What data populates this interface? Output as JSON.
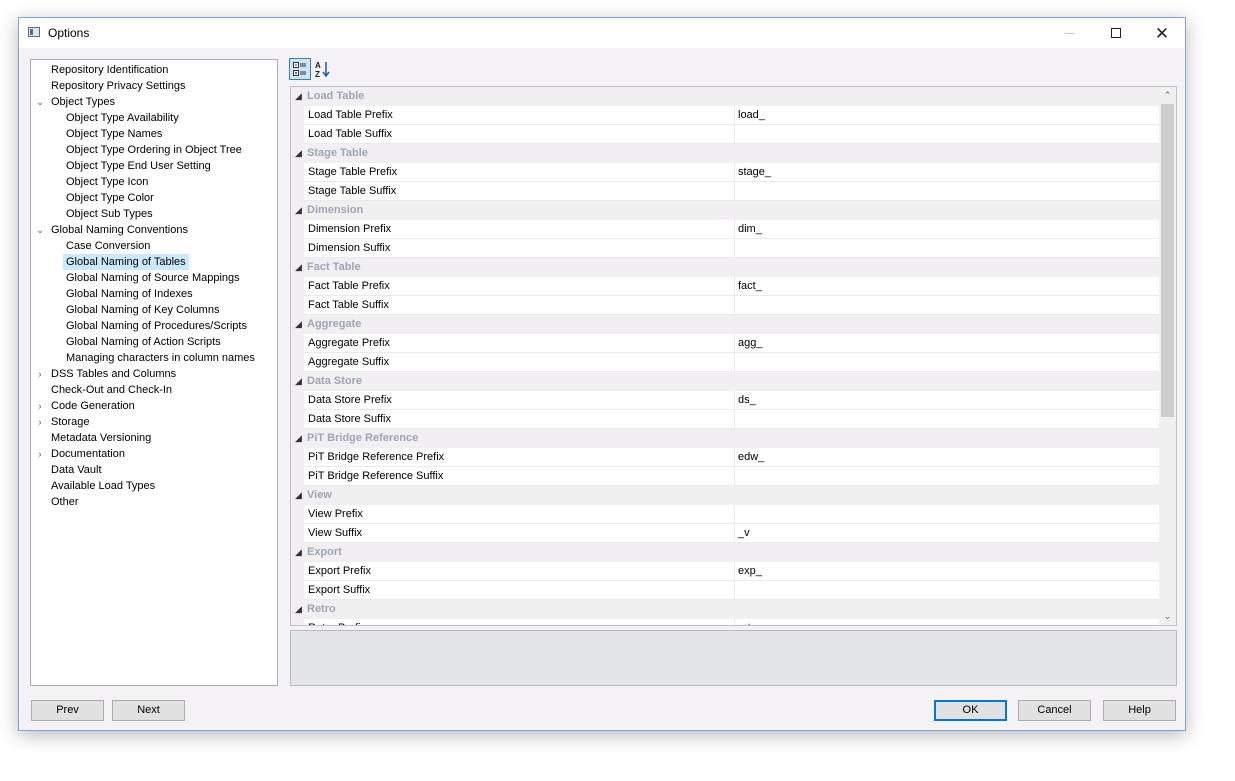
{
  "window": {
    "title": "Options"
  },
  "tree": [
    {
      "label": "Repository Identification",
      "indent": 0,
      "expander": ""
    },
    {
      "label": "Repository Privacy Settings",
      "indent": 0,
      "expander": ""
    },
    {
      "label": "Object Types",
      "indent": 0,
      "expander": "expanded"
    },
    {
      "label": "Object Type Availability",
      "indent": 1,
      "expander": ""
    },
    {
      "label": "Object Type Names",
      "indent": 1,
      "expander": ""
    },
    {
      "label": "Object Type Ordering in Object Tree",
      "indent": 1,
      "expander": ""
    },
    {
      "label": "Object Type End User Setting",
      "indent": 1,
      "expander": ""
    },
    {
      "label": "Object Type Icon",
      "indent": 1,
      "expander": ""
    },
    {
      "label": "Object Type Color",
      "indent": 1,
      "expander": ""
    },
    {
      "label": "Object Sub Types",
      "indent": 1,
      "expander": ""
    },
    {
      "label": "Global Naming Conventions",
      "indent": 0,
      "expander": "expanded"
    },
    {
      "label": "Case Conversion",
      "indent": 1,
      "expander": ""
    },
    {
      "label": "Global Naming of Tables",
      "indent": 1,
      "expander": "",
      "selected": true
    },
    {
      "label": "Global Naming of Source Mappings",
      "indent": 1,
      "expander": ""
    },
    {
      "label": "Global Naming of Indexes",
      "indent": 1,
      "expander": ""
    },
    {
      "label": "Global Naming of Key Columns",
      "indent": 1,
      "expander": ""
    },
    {
      "label": "Global Naming of Procedures/Scripts",
      "indent": 1,
      "expander": ""
    },
    {
      "label": "Global Naming of Action Scripts",
      "indent": 1,
      "expander": ""
    },
    {
      "label": "Managing characters in column names",
      "indent": 1,
      "expander": ""
    },
    {
      "label": "DSS Tables and Columns",
      "indent": 0,
      "expander": "collapsed"
    },
    {
      "label": "Check-Out and Check-In",
      "indent": 0,
      "expander": ""
    },
    {
      "label": "Code Generation",
      "indent": 0,
      "expander": "collapsed"
    },
    {
      "label": "Storage",
      "indent": 0,
      "expander": "collapsed"
    },
    {
      "label": "Metadata Versioning",
      "indent": 0,
      "expander": ""
    },
    {
      "label": "Documentation",
      "indent": 0,
      "expander": "collapsed"
    },
    {
      "label": "Data Vault",
      "indent": 0,
      "expander": ""
    },
    {
      "label": "Available Load Types",
      "indent": 0,
      "expander": ""
    },
    {
      "label": "Other",
      "indent": 0,
      "expander": ""
    }
  ],
  "toolbar": {
    "categorized_icon": "categorized-view-icon",
    "alphabetical_icon": "sort-alphabetical-icon"
  },
  "grid": {
    "categories": [
      {
        "name": "Load Table",
        "props": [
          {
            "name": "Load Table Prefix",
            "value": "load_"
          },
          {
            "name": "Load Table Suffix",
            "value": ""
          }
        ]
      },
      {
        "name": "Stage Table",
        "props": [
          {
            "name": "Stage Table Prefix",
            "value": "stage_"
          },
          {
            "name": "Stage Table Suffix",
            "value": ""
          }
        ]
      },
      {
        "name": "Dimension",
        "props": [
          {
            "name": "Dimension Prefix",
            "value": "dim_"
          },
          {
            "name": "Dimension Suffix",
            "value": ""
          }
        ]
      },
      {
        "name": "Fact Table",
        "props": [
          {
            "name": "Fact Table Prefix",
            "value": "fact_"
          },
          {
            "name": "Fact Table Suffix",
            "value": ""
          }
        ]
      },
      {
        "name": "Aggregate",
        "props": [
          {
            "name": "Aggregate Prefix",
            "value": "agg_"
          },
          {
            "name": "Aggregate Suffix",
            "value": ""
          }
        ]
      },
      {
        "name": "Data Store",
        "props": [
          {
            "name": "Data Store Prefix",
            "value": "ds_"
          },
          {
            "name": "Data Store Suffix",
            "value": ""
          }
        ]
      },
      {
        "name": "PiT Bridge Reference",
        "props": [
          {
            "name": "PiT Bridge Reference Prefix",
            "value": "edw_"
          },
          {
            "name": "PiT Bridge Reference Suffix",
            "value": ""
          }
        ]
      },
      {
        "name": "View",
        "props": [
          {
            "name": "View Prefix",
            "value": ""
          },
          {
            "name": "View Suffix",
            "value": "_v"
          }
        ]
      },
      {
        "name": "Export",
        "props": [
          {
            "name": "Export Prefix",
            "value": "exp_"
          },
          {
            "name": "Export Suffix",
            "value": ""
          }
        ]
      },
      {
        "name": "Retro",
        "props": [
          {
            "name": "Retro Prefix",
            "value": "ret_"
          }
        ]
      }
    ]
  },
  "buttons": {
    "prev": "Prev",
    "next": "Next",
    "ok": "OK",
    "cancel": "Cancel",
    "help": "Help"
  }
}
